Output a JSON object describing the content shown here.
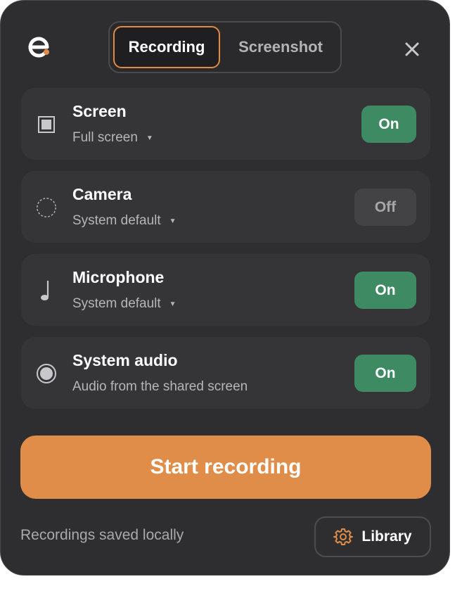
{
  "header": {
    "logo_icon": "eloquent-e-logo",
    "tabs": [
      {
        "label": "Recording",
        "active": true
      },
      {
        "label": "Screenshot",
        "active": false
      }
    ],
    "close_icon": "close-icon"
  },
  "sources": [
    {
      "title": "Screen",
      "subtitle": "Full screen",
      "has_dropdown": true,
      "state": "On",
      "icon": "screen-icon"
    },
    {
      "title": "Camera",
      "subtitle": "System default",
      "has_dropdown": true,
      "state": "Off",
      "icon": "camera-icon"
    },
    {
      "title": "Microphone",
      "subtitle": "System default",
      "has_dropdown": true,
      "state": "On",
      "icon": "microphone-icon"
    },
    {
      "title": "System audio",
      "subtitle": "Audio from the shared screen",
      "has_dropdown": false,
      "state": "On",
      "icon": "system-audio-icon"
    }
  ],
  "actions": {
    "start_label": "Start recording"
  },
  "footer": {
    "status_text": "Recordings saved locally",
    "library_label": "Library",
    "library_icon": "gear-icon"
  },
  "colors": {
    "accent": "#e08d4a",
    "on": "#3e8a63",
    "off": "#434346",
    "background": "#2e2e31",
    "card": "#353538"
  }
}
